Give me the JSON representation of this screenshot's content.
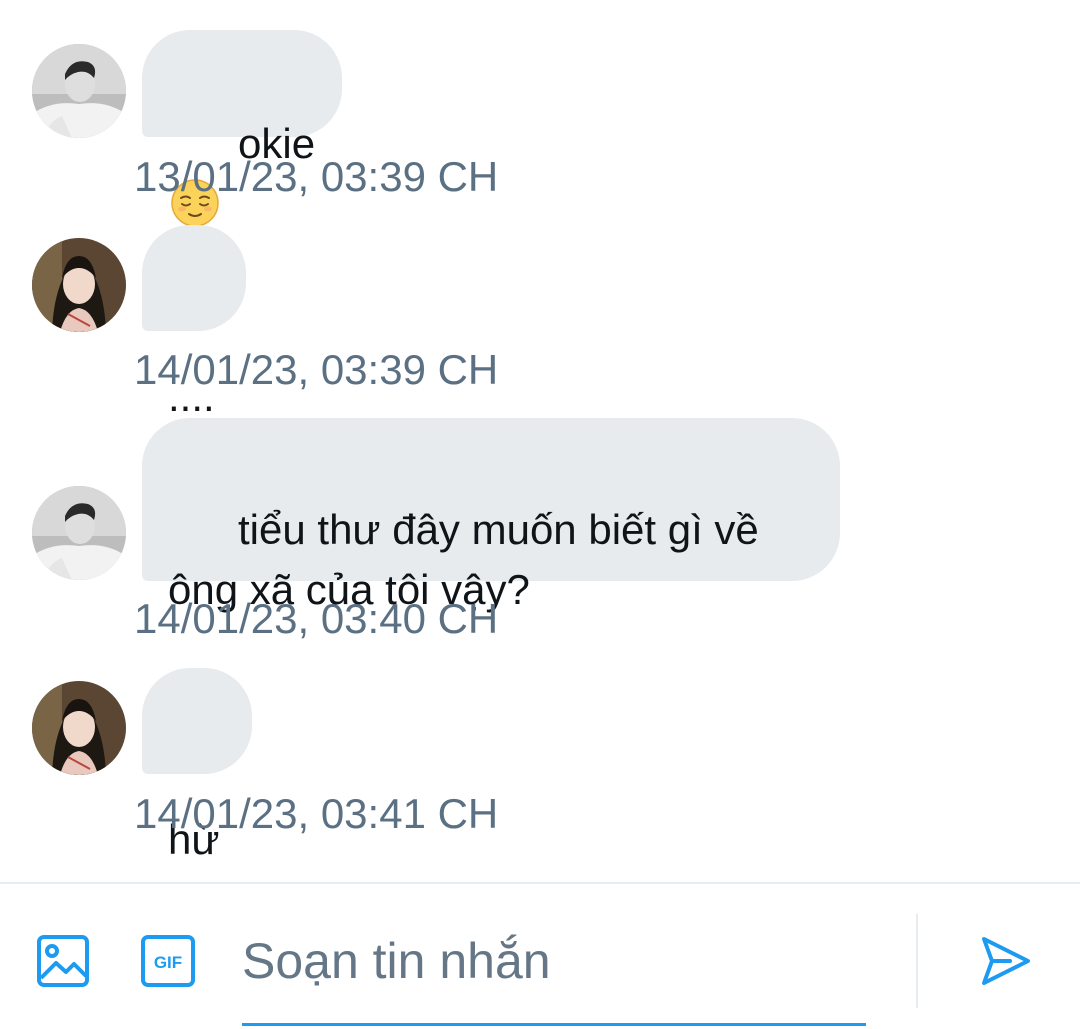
{
  "conversation": {
    "messages": [
      {
        "sender": "male",
        "text": "okie",
        "emoji": "relieved-face-emoji",
        "timestamp": "13/01/23, 03:39 CH"
      },
      {
        "sender": "female",
        "text": "....",
        "timestamp": "14/01/23, 03:39 CH"
      },
      {
        "sender": "male",
        "text": "tiểu thư đây muốn biết gì về\nông xã của tôi vậy?",
        "timestamp": "14/01/23, 03:40 CH"
      },
      {
        "sender": "female",
        "text": "hừ",
        "timestamp": "14/01/23, 03:41 CH"
      }
    ]
  },
  "composer": {
    "placeholder": "Soạn tin nhắn",
    "gif_label": "GIF",
    "icons": [
      "image-icon",
      "gif-icon",
      "send-icon"
    ]
  },
  "colors": {
    "bubble": "#e7ebee",
    "timestamp": "#5b7083",
    "accent": "#1d9bf0"
  }
}
